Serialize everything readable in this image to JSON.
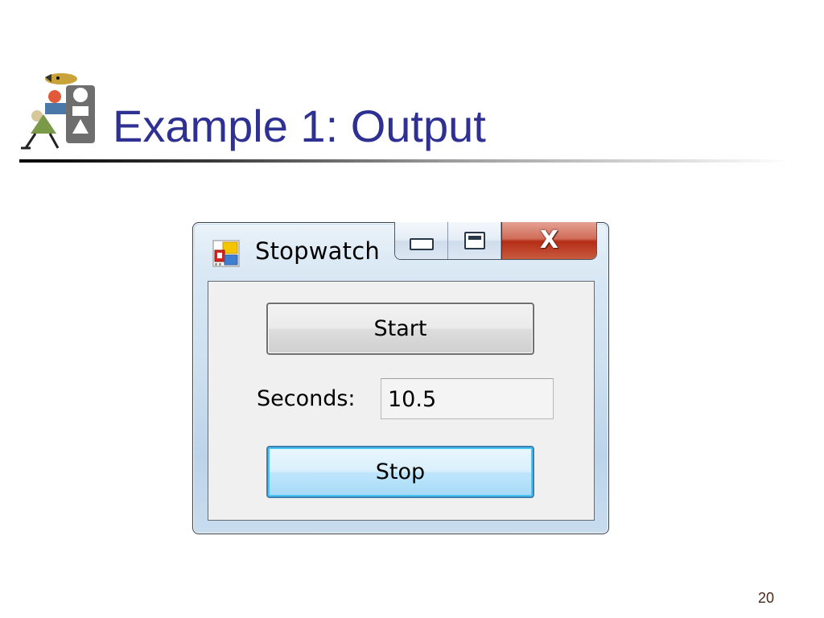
{
  "slide": {
    "title": "Example 1: Output",
    "page_number": "20"
  },
  "window": {
    "title": "Stopwatch",
    "caption_buttons": [
      "minimize",
      "maximize",
      "close"
    ],
    "start_button_label": "Start",
    "seconds_label": "Seconds:",
    "seconds_value": "10.5",
    "stop_button_label": "Stop"
  },
  "colors": {
    "title_text": "#2e3092",
    "close_button": "#c8432b",
    "focused_button_border": "#3c7fb1"
  },
  "icons": [
    "clipart-logo",
    "app-window-icon",
    "minimize-icon",
    "maximize-icon",
    "close-icon"
  ]
}
